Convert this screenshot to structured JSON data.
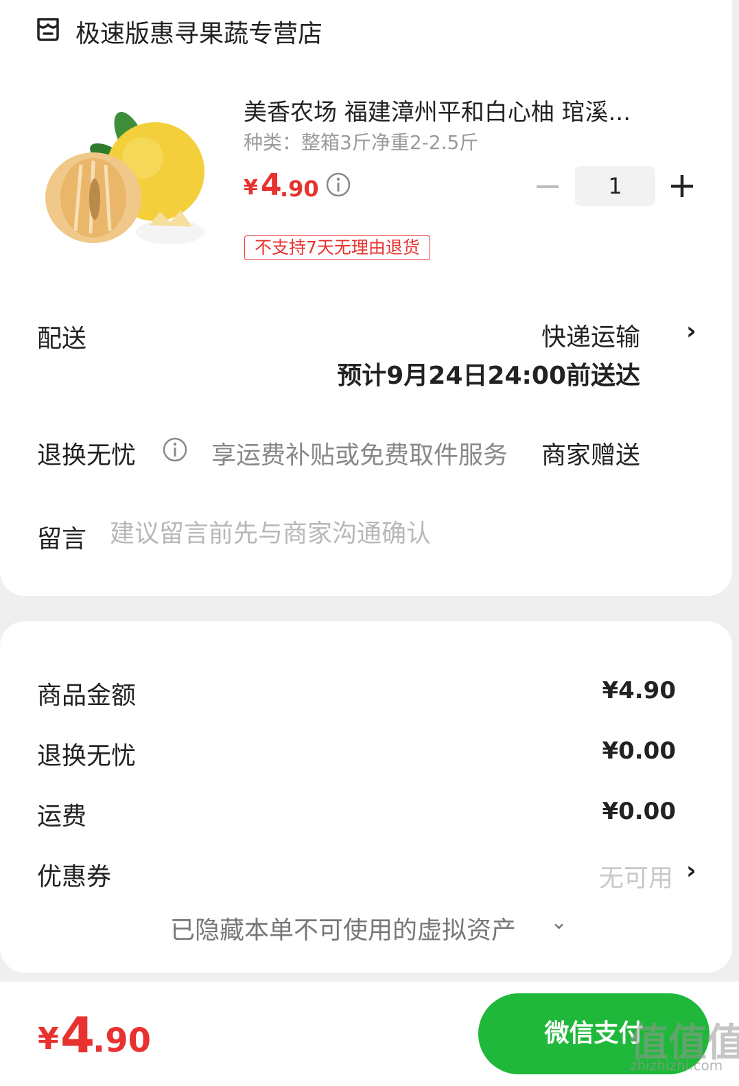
{
  "store": {
    "name": "极速版惠寻果蔬专营店",
    "icon": "store-icon"
  },
  "product": {
    "title": "美香农场 福建漳州平和白心柚 琯溪...",
    "spec": "种类：整箱3斤净重2-2.5斤",
    "price": {
      "symbol": "¥",
      "integer": "4",
      "decimal": ".90"
    },
    "quantity": "1",
    "tag": "不支持7天无理由退货"
  },
  "delivery": {
    "label": "配送",
    "method": "快递运输",
    "eta": "预计9月24日24:00前送达"
  },
  "return_service": {
    "label": "退换无忧",
    "desc": "享运费补贴或免费取件服务",
    "gift": "商家赠送"
  },
  "message": {
    "label": "留言",
    "placeholder": "建议留言前先与商家沟通确认"
  },
  "summary": {
    "goods_label": "商品金额",
    "goods_value": "¥4.90",
    "return_label": "退换无忧",
    "return_value": "¥0.00",
    "shipping_label": "运费",
    "shipping_value": "¥0.00",
    "coupon_label": "优惠券",
    "coupon_value": "无可用",
    "hidden_assets": "已隐藏本单不可使用的虚拟资产"
  },
  "footer": {
    "total": {
      "symbol": "¥",
      "integer": "4",
      "decimal": ".90"
    },
    "pay_label": "微信支付",
    "watermark": "值值值",
    "watermark_sub": "zhizhizhi.com"
  },
  "colors": {
    "price_red": "#e8322f",
    "pay_green": "#1fb83a"
  }
}
